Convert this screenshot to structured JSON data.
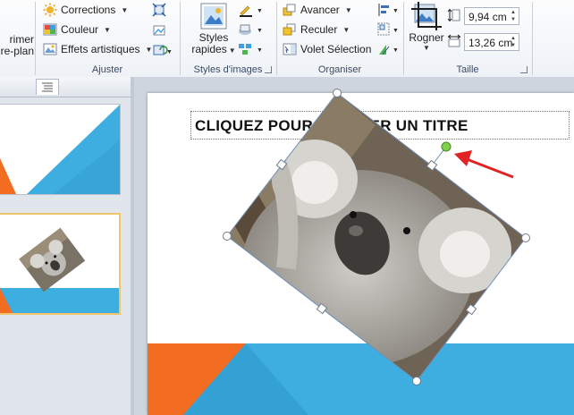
{
  "ribbon": {
    "partial_left_label_top": "rimer",
    "partial_left_label_bottom": "re-plan",
    "ajuster": {
      "corrections": "Corrections",
      "couleur": "Couleur",
      "effets": "Effets artistiques",
      "label": "Ajuster"
    },
    "styles": {
      "rapides_top": "Styles",
      "rapides_bottom": "rapides",
      "label": "Styles d'images"
    },
    "organiser": {
      "avancer": "Avancer",
      "reculer": "Reculer",
      "volet": "Volet Sélection",
      "label": "Organiser"
    },
    "taille": {
      "rogner": "Rogner",
      "height_value": "9,94 cm",
      "width_value": "13,26 cm",
      "label": "Taille"
    }
  },
  "slide": {
    "title_placeholder": "CLIQUEZ POUR AJOUTER UN TITRE"
  },
  "colors": {
    "accent_blue": "#3eaee0",
    "accent_orange": "#f26c21",
    "ribbon_bg": "#f3f6fa",
    "arrow_red": "#e02424",
    "rotation_handle": "#7ed14a"
  },
  "icons": [
    "corrections-icon",
    "couleur-icon",
    "effets-artistiques-icon",
    "styles-rapides-icon",
    "avancer-icon",
    "reculer-icon",
    "volet-selection-icon",
    "rogner-icon",
    "height-icon",
    "width-icon",
    "koala-photo"
  ]
}
